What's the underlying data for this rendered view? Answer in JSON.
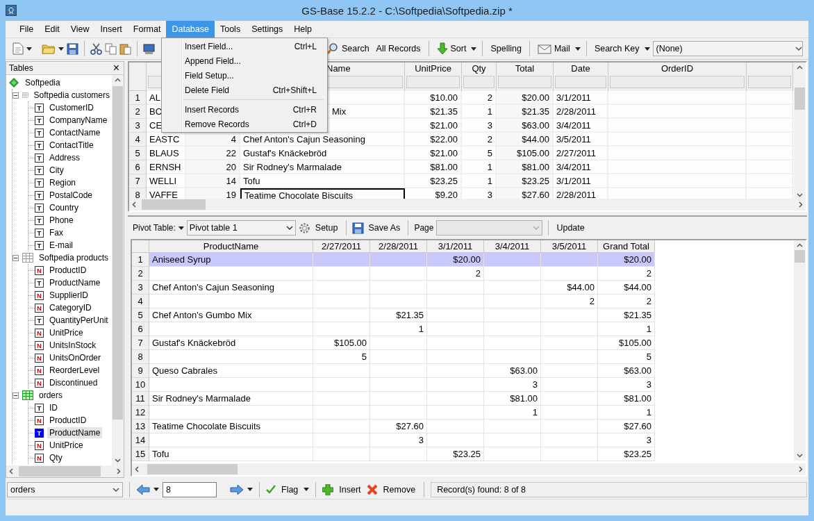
{
  "window": {
    "title": "GS-Base 15.2.2 - C:\\Softpedia\\Softpedia.zip *"
  },
  "menu_bar": [
    {
      "label": "File",
      "selected": false
    },
    {
      "label": "Edit",
      "selected": false
    },
    {
      "label": "View",
      "selected": false
    },
    {
      "label": "Insert",
      "selected": false
    },
    {
      "label": "Format",
      "selected": false
    },
    {
      "label": "Database",
      "selected": true
    },
    {
      "label": "Tools",
      "selected": false
    },
    {
      "label": "Settings",
      "selected": false
    },
    {
      "label": "Help",
      "selected": false
    }
  ],
  "open_menu": [
    {
      "label": "Insert Field...",
      "shortcut": "Ctrl+L"
    },
    {
      "label": "Append Field..."
    },
    {
      "label": "Field Setup..."
    },
    {
      "label": "Delete Field",
      "shortcut": "Ctrl+Shift+L"
    },
    {
      "kind": "separator"
    },
    {
      "label": "Insert Records",
      "shortcut": "Ctrl+R"
    },
    {
      "label": "Remove Records",
      "shortcut": "Ctrl+D"
    }
  ],
  "toolbar": [
    {
      "kind": "button",
      "label": "Search",
      "dropdown": false
    },
    {
      "kind": "button",
      "label": "All Records",
      "dropdown": false
    },
    {
      "kind": "separator"
    },
    {
      "kind": "button",
      "label": "Sort",
      "dropdown": true
    },
    {
      "kind": "separator"
    },
    {
      "kind": "button",
      "label": "Spelling",
      "dropdown": false
    },
    {
      "kind": "separator"
    },
    {
      "kind": "button",
      "label": "Mail",
      "dropdown": true
    },
    {
      "kind": "separator"
    },
    {
      "kind": "button",
      "label": "Search Key",
      "dropdown": true
    },
    {
      "kind": "combo",
      "value": "(None)"
    }
  ],
  "tables_panel": {
    "title": "Tables",
    "close": "×",
    "tree": [
      {
        "label": "Softpedia",
        "kind": "database",
        "children": [
          {
            "label": "Softpedia customers",
            "kind": "table",
            "active": false,
            "expanded": true,
            "children": [
              {
                "label": "CustomerID",
                "kind": "field",
                "type_mark": "T",
                "selected": false
              },
              {
                "label": "CompanyName",
                "kind": "field",
                "type_mark": "T",
                "selected": false
              },
              {
                "label": "ContactName",
                "kind": "field",
                "type_mark": "T",
                "selected": false
              },
              {
                "label": "ContactTitle",
                "kind": "field",
                "type_mark": "T",
                "selected": false
              },
              {
                "label": "Address",
                "kind": "field",
                "type_mark": "T",
                "selected": false
              },
              {
                "label": "City",
                "kind": "field",
                "type_mark": "T",
                "selected": false
              },
              {
                "label": "Region",
                "kind": "field",
                "type_mark": "T",
                "selected": false
              },
              {
                "label": "PostalCode",
                "kind": "field",
                "type_mark": "T",
                "selected": false
              },
              {
                "label": "Country",
                "kind": "field",
                "type_mark": "T",
                "selected": false
              },
              {
                "label": "Phone",
                "kind": "field",
                "type_mark": "T",
                "selected": false
              },
              {
                "label": "Fax",
                "kind": "field",
                "type_mark": "T",
                "selected": false
              },
              {
                "label": "E-mail",
                "kind": "field",
                "type_mark": "T",
                "selected": false
              }
            ]
          },
          {
            "label": "Softpedia products",
            "kind": "table",
            "active": false,
            "expanded": true,
            "children": [
              {
                "label": "ProductID",
                "kind": "field",
                "type_mark": "N",
                "selected": false
              },
              {
                "label": "ProductName",
                "kind": "field",
                "type_mark": "T",
                "selected": false
              },
              {
                "label": "SupplierID",
                "kind": "field",
                "type_mark": "N",
                "selected": false
              },
              {
                "label": "CategoryID",
                "kind": "field",
                "type_mark": "N",
                "selected": false
              },
              {
                "label": "QuantityPerUnit",
                "kind": "field",
                "type_mark": "T",
                "selected": false
              },
              {
                "label": "UnitPrice",
                "kind": "field",
                "type_mark": "N",
                "selected": false
              },
              {
                "label": "UnitsInStock",
                "kind": "field",
                "type_mark": "N",
                "selected": false
              },
              {
                "label": "UnitsOnOrder",
                "kind": "field",
                "type_mark": "N",
                "selected": false
              },
              {
                "label": "ReorderLevel",
                "kind": "field",
                "type_mark": "N",
                "selected": false
              },
              {
                "label": "Discontinued",
                "kind": "field",
                "type_mark": "N",
                "selected": false
              }
            ]
          },
          {
            "label": "orders",
            "kind": "table",
            "active": true,
            "expanded": true,
            "children": [
              {
                "label": "ID",
                "kind": "field",
                "type_mark": "T",
                "selected": false
              },
              {
                "label": "ProductID",
                "kind": "field",
                "type_mark": "N",
                "selected": false
              },
              {
                "label": "ProductName",
                "kind": "field",
                "type_mark": "T",
                "selected": true
              },
              {
                "label": "UnitPrice",
                "kind": "field",
                "type_mark": "N",
                "selected": false
              },
              {
                "label": "Qty",
                "kind": "field",
                "type_mark": "N",
                "selected": false
              }
            ]
          }
        ]
      }
    ]
  },
  "records_grid": {
    "columns": [
      null,
      null,
      {
        "label": "Name",
        "partly_hidden": true
      },
      {
        "label": "UnitPrice"
      },
      {
        "label": "Qty"
      },
      {
        "label": "Total"
      },
      {
        "label": "Date"
      },
      {
        "label": "OrderID"
      },
      null,
      null
    ],
    "rows": [
      {
        "num": "1",
        "selected": false,
        "cells": [
          "AL",
          null,
          null,
          "$10.00",
          "2",
          "$20.00",
          "3/1/2011",
          null,
          null,
          null
        ]
      },
      {
        "num": "2",
        "selected": false,
        "cells": [
          "BO",
          null,
          {
            "text": "Mix",
            "partly_hidden": true
          },
          "$21.35",
          "1",
          "$21.35",
          "2/28/2011",
          null,
          null,
          null
        ]
      },
      {
        "num": "3",
        "selected": false,
        "cells": [
          "CE",
          null,
          null,
          "$21.00",
          "3",
          "$63.00",
          "3/4/2011",
          null,
          null,
          null
        ]
      },
      {
        "num": "4",
        "selected": false,
        "cells": [
          "EASTC",
          "4",
          "Chef Anton's Cajun Seasoning",
          "$22.00",
          "2",
          "$44.00",
          "3/5/2011",
          null,
          null,
          null
        ]
      },
      {
        "num": "5",
        "selected": false,
        "cells": [
          "BLAUS",
          "22",
          "Gustaf's Knäckebröd",
          "$21.00",
          "5",
          "$105.00",
          "2/27/2011",
          null,
          null,
          null
        ]
      },
      {
        "num": "6",
        "selected": false,
        "cells": [
          "ERNSH",
          "20",
          "Sir Rodney's Marmalade",
          "$81.00",
          "1",
          "$81.00",
          "3/4/2011",
          null,
          null,
          null
        ]
      },
      {
        "num": "7",
        "selected": false,
        "cells": [
          "WELLI",
          "14",
          "Tofu",
          "$23.25",
          "1",
          "$23.25",
          "3/1/2011",
          null,
          null,
          null
        ]
      },
      {
        "num": "8",
        "selected": true,
        "cells": [
          "VAFFE",
          "19",
          "Teatime Chocolate Biscuits",
          "$9.20",
          "3",
          "$27.60",
          "2/28/2011",
          null,
          null,
          null
        ]
      }
    ]
  },
  "pivot_toolbar": {
    "label": "Pivot Table:",
    "table": "Pivot table 1",
    "setup": "Setup",
    "save_as": "Save As",
    "page_label": "Page",
    "page_disabled": true,
    "update": "Update"
  },
  "pivot_grid": {
    "columns": [
      "ProductName",
      "2/27/2011",
      "2/28/2011",
      "3/1/2011",
      "3/4/2011",
      "3/5/2011",
      "Grand Total"
    ],
    "rows": [
      {
        "num": "1",
        "selected": true,
        "cells": [
          "Aniseed Syrup",
          null,
          null,
          "$20.00",
          null,
          null,
          "$20.00"
        ]
      },
      {
        "num": "2",
        "selected": false,
        "cells": [
          null,
          null,
          null,
          "2",
          null,
          null,
          "2"
        ]
      },
      {
        "num": "3",
        "selected": false,
        "cells": [
          "Chef Anton's Cajun Seasoning",
          null,
          null,
          null,
          null,
          "$44.00",
          "$44.00"
        ]
      },
      {
        "num": "4",
        "selected": false,
        "cells": [
          null,
          null,
          null,
          null,
          null,
          "2",
          "2"
        ]
      },
      {
        "num": "5",
        "selected": false,
        "cells": [
          "Chef Anton's Gumbo Mix",
          null,
          "$21.35",
          null,
          null,
          null,
          "$21.35"
        ]
      },
      {
        "num": "6",
        "selected": false,
        "cells": [
          null,
          null,
          "1",
          null,
          null,
          null,
          "1"
        ]
      },
      {
        "num": "7",
        "selected": false,
        "cells": [
          "Gustaf's Knäckebröd",
          "$105.00",
          null,
          null,
          null,
          null,
          "$105.00"
        ]
      },
      {
        "num": "8",
        "selected": false,
        "cells": [
          null,
          "5",
          null,
          null,
          null,
          null,
          "5"
        ]
      },
      {
        "num": "9",
        "selected": false,
        "cells": [
          "Queso Cabrales",
          null,
          null,
          null,
          "$63.00",
          null,
          "$63.00"
        ]
      },
      {
        "num": "10",
        "selected": false,
        "cells": [
          null,
          null,
          null,
          null,
          "3",
          null,
          "3"
        ]
      },
      {
        "num": "11",
        "selected": false,
        "cells": [
          "Sir Rodney's Marmalade",
          null,
          null,
          null,
          "$81.00",
          null,
          "$81.00"
        ]
      },
      {
        "num": "12",
        "selected": false,
        "cells": [
          null,
          null,
          null,
          null,
          "1",
          null,
          "1"
        ]
      },
      {
        "num": "13",
        "selected": false,
        "cells": [
          "Teatime Chocolate Biscuits",
          null,
          "$27.60",
          null,
          null,
          null,
          "$27.60"
        ]
      },
      {
        "num": "14",
        "selected": false,
        "cells": [
          null,
          null,
          "3",
          null,
          null,
          null,
          "3"
        ]
      },
      {
        "num": "15",
        "selected": false,
        "cells": [
          "Tofu",
          null,
          null,
          "$23.25",
          null,
          null,
          "$23.25"
        ]
      }
    ]
  },
  "bottom_bar": {
    "table": "orders",
    "record": "8",
    "flag": "Flag",
    "insert": "Insert",
    "remove": "Remove",
    "status": "Record(s) found: 8 of 8"
  }
}
